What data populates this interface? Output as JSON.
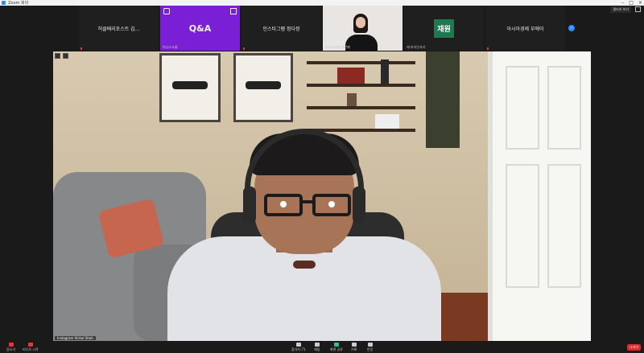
{
  "window": {
    "title": "Zoom 회의",
    "view_label": "갤러리 보기"
  },
  "strip": {
    "tiles": [
      {
        "text": "허클베리포스트 김...",
        "label": ""
      },
      {
        "text": "Q&A",
        "label": "미니스크쿨"
      },
      {
        "text": "인스타그램 정다정",
        "label": ""
      },
      {
        "text": "",
        "label": "미니스크쿨 마인페"
      },
      {
        "text": "재원",
        "label": "재 마지인사키"
      },
      {
        "text": "아시아경제 부에이",
        "label": ""
      }
    ]
  },
  "main_video": {
    "name": "Instagram Vishal Shah"
  },
  "toolbar": {
    "mute": "음소거",
    "video": "비디오 시작",
    "participants": "참가자",
    "participants_count": "71",
    "chat": "채팅",
    "share": "화면 공유",
    "record": "기록",
    "reactions": "반응",
    "leave": "나가기"
  },
  "colors": {
    "qa_tile": "#7b1fd6",
    "logo_tile": "#1c7a4e",
    "share": "#2ec27e",
    "leave": "#e02828",
    "accent": "#2d8cff"
  }
}
